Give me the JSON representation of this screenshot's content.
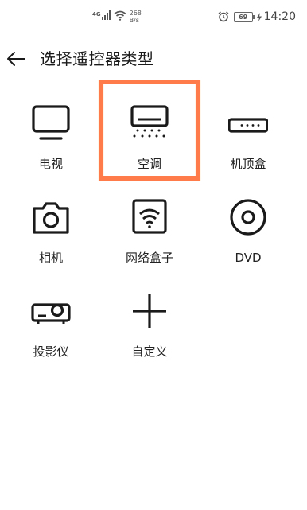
{
  "status_bar": {
    "network_type": "4G",
    "speed_value": "268",
    "speed_unit": "B/s",
    "battery_level": "69",
    "time": "14:20"
  },
  "header": {
    "title": "选择遥控器类型"
  },
  "highlight_color": "#ff7b4a",
  "devices": [
    {
      "label": "电视",
      "icon": "tv-icon"
    },
    {
      "label": "空调",
      "icon": "air-conditioner-icon"
    },
    {
      "label": "机顶盒",
      "icon": "set-top-box-icon"
    },
    {
      "label": "相机",
      "icon": "camera-icon"
    },
    {
      "label": "网络盒子",
      "icon": "network-box-icon"
    },
    {
      "label": "DVD",
      "icon": "dvd-icon"
    },
    {
      "label": "投影仪",
      "icon": "projector-icon"
    },
    {
      "label": "自定义",
      "icon": "plus-icon"
    }
  ]
}
